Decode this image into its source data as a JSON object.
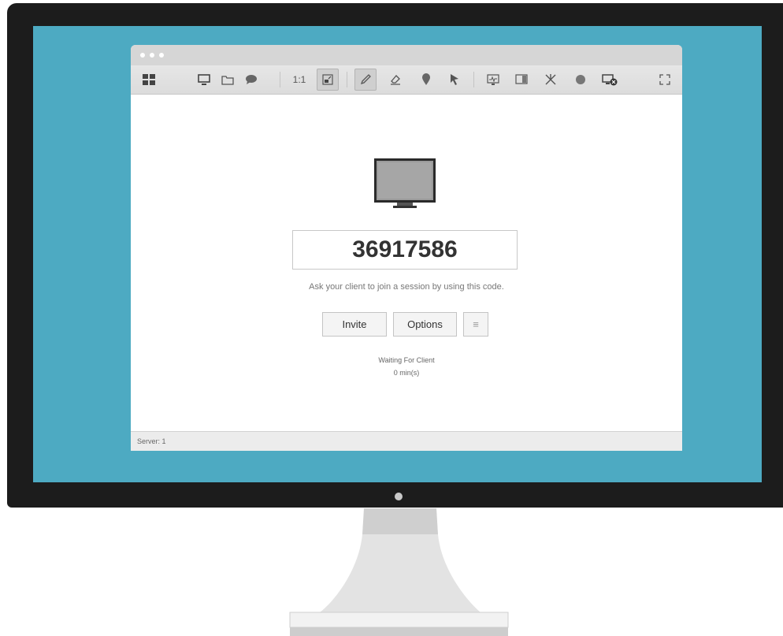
{
  "toolbar": {
    "actual_size_label": "1:1",
    "icons": [
      "grid-icon",
      "display-icon",
      "folder-icon",
      "chat-icon",
      "actual-size",
      "fit-screen-icon",
      "pencil-icon",
      "eraser-icon",
      "marker-icon",
      "pointer-icon",
      "monitor-view-icon",
      "window-icon",
      "tools-icon",
      "record-icon",
      "disconnect-screen-icon",
      "fullscreen-icon"
    ]
  },
  "session": {
    "code": "36917586",
    "hint": "Ask your client to join a session by using this code.",
    "invite_label": "Invite",
    "options_label": "Options",
    "menu_label": "≡",
    "status": "Waiting For Client",
    "elapsed": "0 min(s)"
  },
  "status_bar": {
    "server": "Server: 1"
  },
  "colors": {
    "screen_bg": "#4daac2",
    "bezel": "#1c1c1c",
    "toolbar_bg": "#e0e0e0"
  }
}
